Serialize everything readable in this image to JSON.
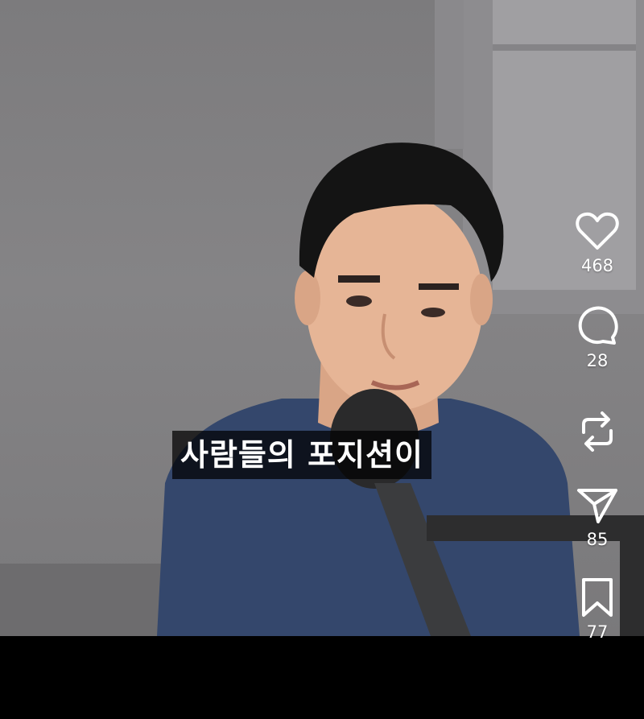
{
  "reel": {
    "caption": "사람들의 포지션이"
  },
  "actions": {
    "like": {
      "icon": "heart-icon",
      "count": "468"
    },
    "comment": {
      "icon": "comment-bubble-icon",
      "count": "28"
    },
    "repost": {
      "icon": "repost-icon"
    },
    "share": {
      "icon": "paper-plane-icon",
      "count": "85"
    },
    "save": {
      "icon": "bookmark-icon",
      "count": "77"
    }
  },
  "colors": {
    "wall": "#808082",
    "sweater": "#34476c",
    "overlay_text": "#ffffff",
    "bar": "#000000"
  }
}
